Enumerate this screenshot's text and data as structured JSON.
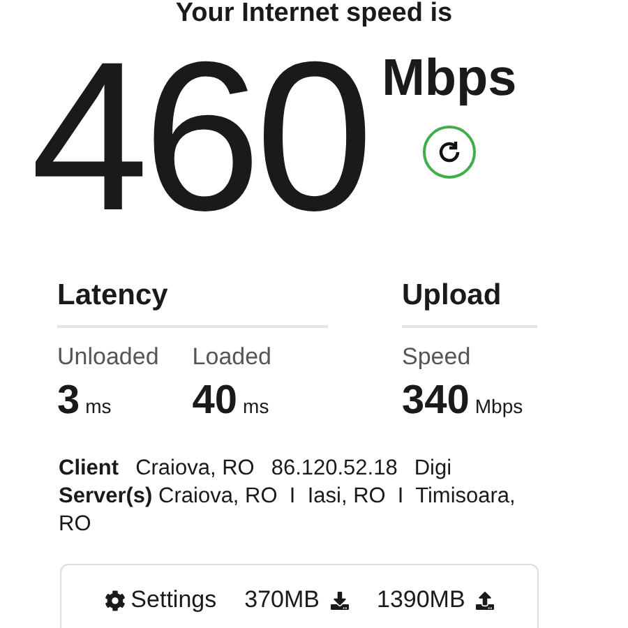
{
  "header": "Your Internet speed is",
  "speed": {
    "value": "460",
    "unit": "Mbps"
  },
  "latency": {
    "title": "Latency",
    "metrics": [
      {
        "label": "Unloaded",
        "value": "3",
        "unit": "ms"
      },
      {
        "label": "Loaded",
        "value": "40",
        "unit": "ms"
      }
    ]
  },
  "upload": {
    "title": "Upload",
    "metrics": [
      {
        "label": "Speed",
        "value": "340",
        "unit": "Mbps"
      }
    ]
  },
  "client": {
    "label": "Client",
    "location": "Craiova, RO",
    "ip": "86.120.52.18",
    "isp": "Digi"
  },
  "servers": "**Server(s)** Craiova, RO  I  Iasi, RO  I  Timisoara, RO",
  "footer": {
    "settings": "Settings",
    "download": "370MB",
    "upload": "1390MB"
  }
}
